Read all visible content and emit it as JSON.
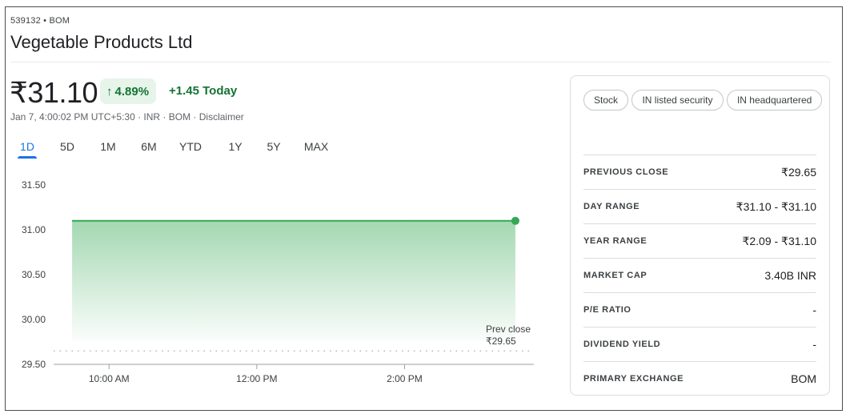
{
  "header": {
    "ticker": "539132 • BOM",
    "company": "Vegetable Products Ltd"
  },
  "quote": {
    "price": "₹31.10",
    "change_pct": "4.89%",
    "change_today": "+1.45 Today",
    "subinfo": "Jan 7, 4:00:02 PM UTC+5:30 · INR · BOM · Disclaimer"
  },
  "tabs": [
    {
      "label": "1D",
      "active": true
    },
    {
      "label": "5D",
      "active": false
    },
    {
      "label": "1M",
      "active": false
    },
    {
      "label": "6M",
      "active": false
    },
    {
      "label": "YTD",
      "active": false
    },
    {
      "label": "1Y",
      "active": false
    },
    {
      "label": "5Y",
      "active": false
    },
    {
      "label": "MAX",
      "active": false
    }
  ],
  "chart_data": {
    "type": "area",
    "y_ticks": [
      "31.50",
      "31.00",
      "30.50",
      "30.00",
      "29.50"
    ],
    "ylim": [
      29.5,
      31.5
    ],
    "x_ticks": [
      "10:00 AM",
      "12:00 PM",
      "2:00 PM"
    ],
    "x_tick_hours": [
      10,
      12,
      14
    ],
    "xlim_hours": [
      9.25,
      15.75
    ],
    "series": [
      {
        "x_hours": [
          9.5,
          15.5
        ],
        "y": [
          31.1,
          31.1
        ]
      }
    ],
    "prev_close": {
      "label": "Prev close",
      "value_label": "₹29.65",
      "value": 29.65
    },
    "line_color": "#34a853",
    "fill_color": "#34a853"
  },
  "panel": {
    "chips": [
      "Stock",
      "IN listed security",
      "IN headquartered"
    ],
    "stats": [
      {
        "label": "PREVIOUS CLOSE",
        "value": "₹29.65"
      },
      {
        "label": "DAY RANGE",
        "value": "₹31.10 - ₹31.10"
      },
      {
        "label": "YEAR RANGE",
        "value": "₹2.09 - ₹31.10"
      },
      {
        "label": "MARKET CAP",
        "value": "3.40B INR"
      },
      {
        "label": "P/E RATIO",
        "value": "-"
      },
      {
        "label": "DIVIDEND YIELD",
        "value": "-"
      },
      {
        "label": "PRIMARY EXCHANGE",
        "value": "BOM"
      }
    ]
  }
}
